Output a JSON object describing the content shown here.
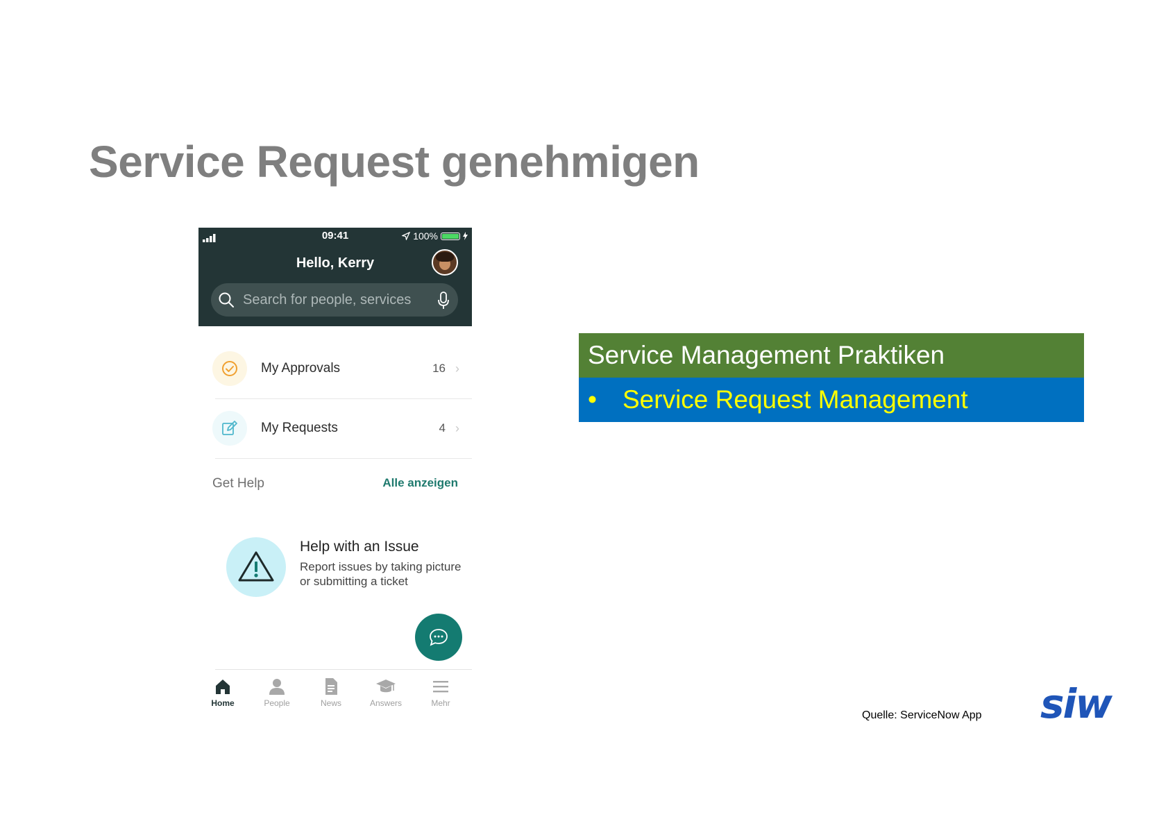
{
  "slide": {
    "title": "Service Request genehmigen",
    "source_note": "Quelle: ServiceNow App",
    "logo_text": "siw"
  },
  "phone": {
    "status": {
      "time": "09:41",
      "battery": "100%",
      "battery_level": 1.0
    },
    "greeting": "Hello, Kerry",
    "search": {
      "placeholder": "Search for people, services"
    },
    "list": [
      {
        "label": "My Approvals",
        "count": "16",
        "icon": "approval-check-icon"
      },
      {
        "label": "My Requests",
        "count": "4",
        "icon": "edit-request-icon"
      }
    ],
    "get_help": {
      "label": "Get Help",
      "see_all": "Alle anzeigen"
    },
    "help_card": {
      "title": "Help with an Issue",
      "description": "Report issues by taking picture or submitting a ticket",
      "icon": "warning-triangle-icon"
    },
    "tabs": [
      {
        "label": "Home",
        "icon": "home-icon",
        "active": true
      },
      {
        "label": "People",
        "icon": "person-icon",
        "active": false
      },
      {
        "label": "News",
        "icon": "document-icon",
        "active": false
      },
      {
        "label": "Answers",
        "icon": "graduation-cap-icon",
        "active": false
      },
      {
        "label": "Mehr",
        "icon": "menu-icon",
        "active": false
      }
    ]
  },
  "practice": {
    "header": "Service Management Praktiken",
    "items": [
      "Service Request Management"
    ],
    "bullet": "•"
  },
  "colors": {
    "title_gray": "#7f7f7f",
    "phone_header": "#233536",
    "practice_header_green": "#538135",
    "practice_item_blue": "#0070c0",
    "practice_item_text": "#ffff00",
    "accent_teal": "#147b71",
    "logo_blue": "#1f55b8"
  }
}
